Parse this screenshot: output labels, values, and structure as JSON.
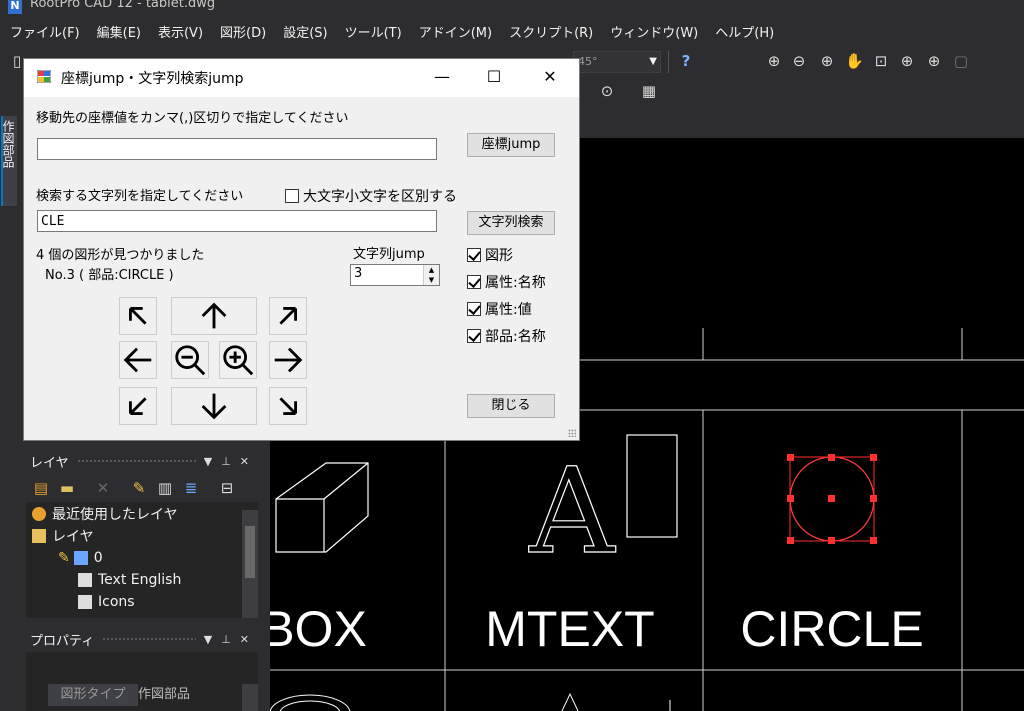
{
  "app": {
    "title": "RootPro CAD 12 - tablet.dwg",
    "logo_letter": "N"
  },
  "menubar": [
    "ファイル(F)",
    "編集(E)",
    "表示(V)",
    "図形(D)",
    "設定(S)",
    "ツール(T)",
    "アドイン(M)",
    "スクリプト(R)",
    "ウィンドウ(W)",
    "ヘルプ(H)"
  ],
  "toolbar": {
    "angle_value": "45°"
  },
  "left_strip": {
    "tab_label": "作図部品"
  },
  "dialog": {
    "title": "座標jump・文字列検索jump",
    "coord_label": "移動先の座標値をカンマ(,)区切りで指定してください",
    "coord_value": "",
    "coord_button": "座標jump",
    "search_label": "検索する文字列を指定してください",
    "case_checkbox": "大文字小文字を区別する",
    "case_checked": false,
    "search_value": "CLE",
    "search_button": "文字列検索",
    "result_count": "4 個の図形が見つかりました",
    "result_item": "No.3 ( 部品:CIRCLE )",
    "jump_label": "文字列jump",
    "jump_value": "3",
    "checks": [
      {
        "label": "図形",
        "checked": true
      },
      {
        "label": "属性:名称",
        "checked": true
      },
      {
        "label": "属性:値",
        "checked": true
      },
      {
        "label": "部品:名称",
        "checked": true
      }
    ],
    "close_button": "閉じる"
  },
  "layer_panel": {
    "title": "レイヤ",
    "items": [
      {
        "label": "最近使用したレイヤ"
      },
      {
        "label": "レイヤ"
      },
      {
        "label": "0"
      },
      {
        "label": "Text English"
      },
      {
        "label": "Icons"
      }
    ]
  },
  "property_panel": {
    "title": "プロパティ",
    "tabs": [
      "図形タイプ",
      "作図部品"
    ]
  },
  "canvas": {
    "labels": [
      "BOX",
      "MTEXT",
      "CIRCLE"
    ],
    "letter": "A"
  }
}
